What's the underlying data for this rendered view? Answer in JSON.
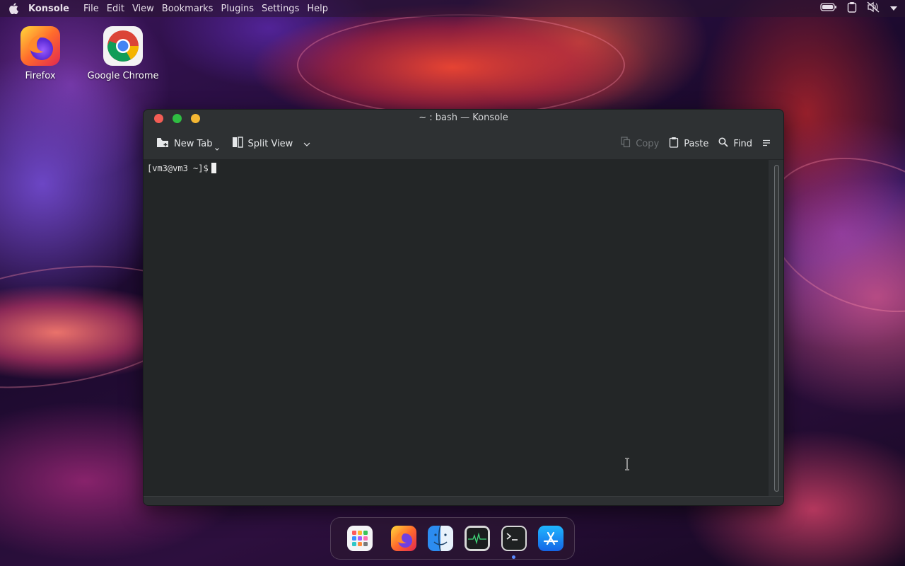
{
  "top_panel": {
    "app_name": "Konsole",
    "menus": [
      "File",
      "Edit",
      "View",
      "Bookmarks",
      "Plugins",
      "Settings",
      "Help"
    ],
    "tray_icons": [
      "battery-icon",
      "clipboard-icon",
      "volume-muted-icon",
      "chevron-down-icon"
    ]
  },
  "desktop": {
    "icons": [
      {
        "label": "Firefox",
        "icon": "firefox-icon"
      },
      {
        "label": "Google Chrome",
        "icon": "chrome-icon"
      }
    ]
  },
  "window": {
    "title": "~ : bash — Konsole",
    "toolbar": {
      "new_tab": "New Tab",
      "split_view": "Split View",
      "copy": "Copy",
      "paste": "Paste",
      "find": "Find"
    },
    "terminal": {
      "prompt": "[vm3@vm3 ~]$"
    }
  },
  "dock": {
    "items": [
      "app-launcher-icon",
      "firefox-icon",
      "finder-icon",
      "activity-monitor-icon",
      "terminal-icon",
      "app-store-icon"
    ]
  },
  "colors": {
    "terminal_bg": "#232627",
    "window_bg": "#2d3032",
    "close": "#f25d55",
    "maximize": "#2fbd42",
    "minimize": "#f4b733"
  }
}
